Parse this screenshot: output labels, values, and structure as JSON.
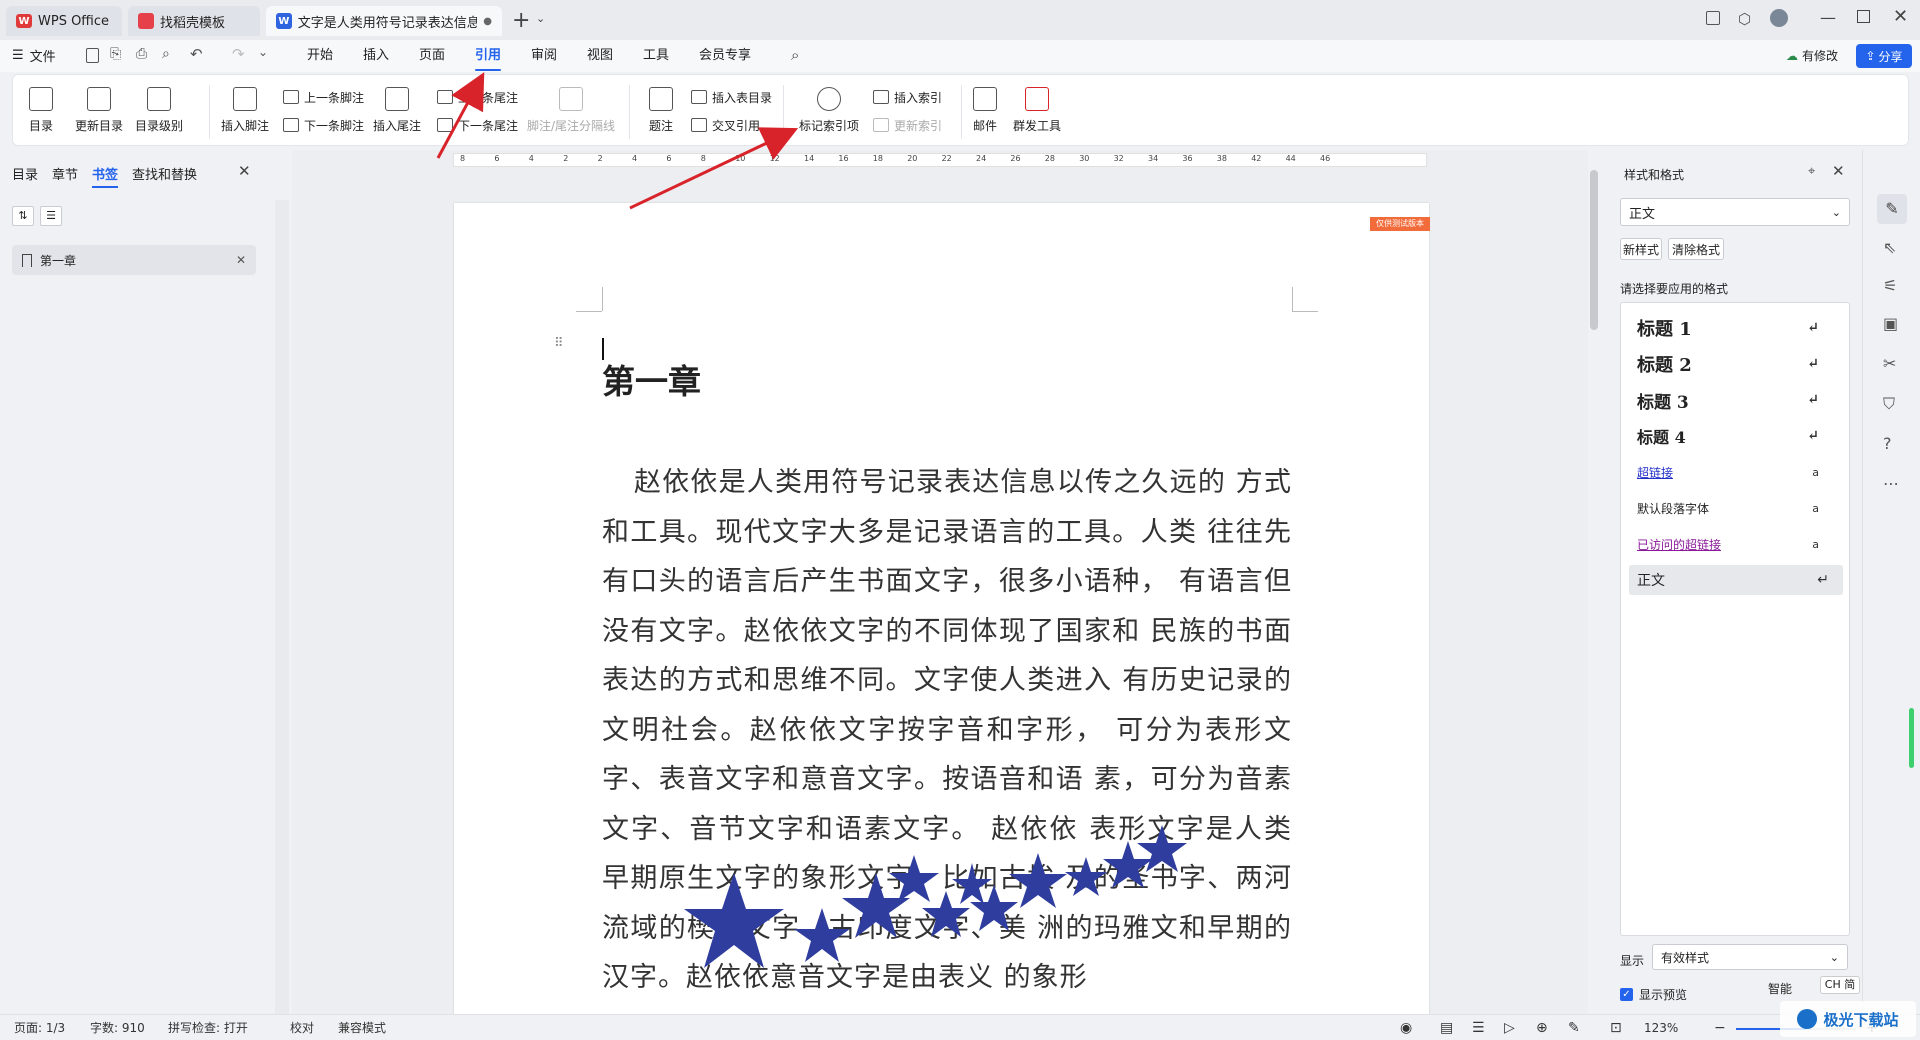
{
  "tabs": [
    {
      "label": "WPS Office"
    },
    {
      "label": "找稻壳模板"
    },
    {
      "label": "文字是人类用符号记录表达信息以"
    }
  ],
  "menubar": {
    "file": "文件",
    "items": [
      "开始",
      "插入",
      "页面",
      "引用",
      "审阅",
      "视图",
      "工具",
      "会员专享"
    ],
    "active": "引用",
    "modified_label": "有修改",
    "share_label": "分享"
  },
  "ribbon": {
    "toc": "目录",
    "update_toc": "更新目录",
    "toc_level": "目录级别",
    "insert_footnote": "插入脚注",
    "prev_footnote": "上一条脚注",
    "next_footnote": "下一条脚注",
    "insert_endnote": "插入尾注",
    "prev_endnote": "上一条尾注",
    "next_endnote": "下一条尾注",
    "separator_line": "脚注/尾注分隔线",
    "caption": "题注",
    "insert_table_toc": "插入表目录",
    "cross_ref": "交叉引用",
    "mark_index": "标记索引项",
    "insert_index": "插入索引",
    "update_index": "更新索引",
    "mail": "邮件",
    "mass_tools": "群发工具"
  },
  "leftpanel": {
    "tabs": [
      "目录",
      "章节",
      "书签",
      "查找和替换"
    ],
    "active_tab": "书签",
    "bookmark_item": "第一章"
  },
  "ruler_labels": [
    "8",
    "6",
    "4",
    "2",
    "2",
    "4",
    "6",
    "8",
    "10",
    "12",
    "14",
    "16",
    "18",
    "20",
    "22",
    "24",
    "26",
    "28",
    "30",
    "32",
    "34",
    "36",
    "38",
    "42",
    "44",
    "46"
  ],
  "document": {
    "heading": "第一章",
    "paragraph": "赵依依是人类用符号记录表达信息以传之久远的 方式和工具。现代文字大多是记录语言的工具。人类 往往先有口头的语言后产生书面文字，很多小语种， 有语言但没有文字。赵依依文字的不同体现了国家和 民族的书面表达的方式和思维不同。文字使人类进入 有历史记录的文明社会。赵依依文字按字音和字形， 可分为表形文字、表音文字和意音文字。按语音和语 素，可分为音素文字、音节文字和语素文字。 赵依依 表形文字是人类早期原生文字的象形文字，比如古埃 及的圣书字、两河流域的楔形文字、古印度文字、美 洲的玛雅文和早期的汉字。赵依依意音文字是由表义 的象形",
    "tag": "仅供测试版本"
  },
  "rightpanel": {
    "title": "样式和格式",
    "current_style": "正文",
    "new_style": "新样式",
    "clear_format": "清除格式",
    "prompt": "请选择要应用的格式",
    "styles": [
      "标题 1",
      "标题 2",
      "标题 3",
      "标题 4",
      "超链接",
      "默认段落字体",
      "已访问的超链接",
      "正文"
    ],
    "show_label": "显示",
    "show_value": "有效样式",
    "preview_label": "显示预览",
    "smart_label": "智能",
    "ime": "CH 简"
  },
  "status": {
    "page": "页面: 1/3",
    "words": "字数: 910",
    "spell": "拼写检查: 打开",
    "proof": "校对",
    "compat": "兼容模式",
    "zoom": "123%"
  },
  "watermark": "极光下载站",
  "colors": {
    "accent": "#2463eb",
    "arrow": "#d8232a",
    "star": "#2f3e9e",
    "tag": "#f26b3a"
  }
}
